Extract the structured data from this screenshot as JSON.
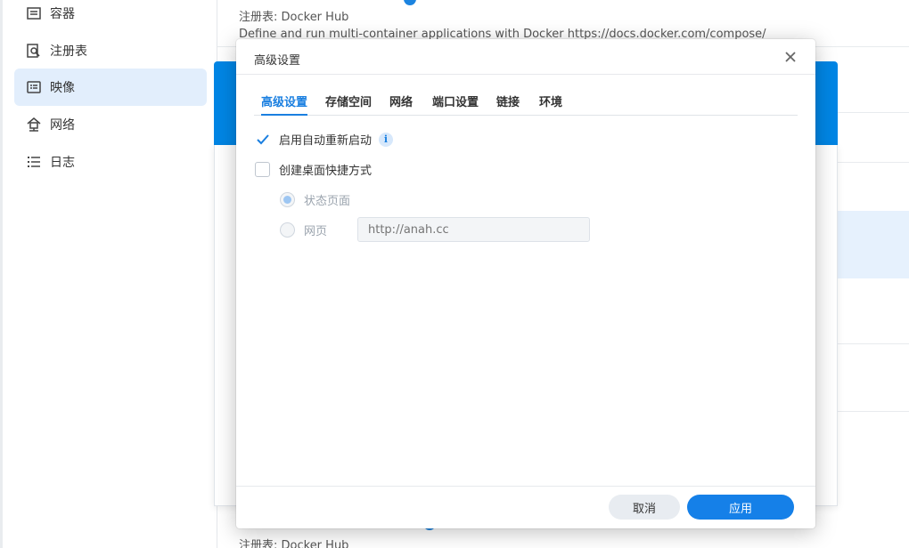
{
  "sidebar": {
    "items": [
      {
        "label": "容器",
        "icon": "container-list-icon"
      },
      {
        "label": "注册表",
        "icon": "registry-search-icon"
      },
      {
        "label": "映像",
        "icon": "image-icon",
        "active": true
      },
      {
        "label": "网络",
        "icon": "network-icon"
      },
      {
        "label": "日志",
        "icon": "log-list-icon"
      }
    ]
  },
  "background": {
    "registry_line": "注册表: Docker Hub",
    "description_line": "Define and run multi-container applications with Docker https://docs.docker.com/compose/",
    "registry_line_bottom": "注册表: Docker Hub"
  },
  "dialog": {
    "title": "高级设置",
    "tabs": [
      {
        "label": "高级设置",
        "active": true
      },
      {
        "label": "存储空间"
      },
      {
        "label": "网络"
      },
      {
        "label": "端口设置"
      },
      {
        "label": "链接"
      },
      {
        "label": "环境"
      }
    ],
    "auto_restart": {
      "label": "启用自动重新启动",
      "checked": true
    },
    "desktop_shortcut": {
      "label": "创建桌面快捷方式",
      "checked": false
    },
    "status_page": {
      "label": "状态页面",
      "selected": true
    },
    "web_page": {
      "label": "网页",
      "selected": false
    },
    "url_input": {
      "placeholder": "http://anah.cc"
    },
    "cancel_label": "取消",
    "apply_label": "应用"
  },
  "colors": {
    "accent": "#1580e8",
    "active_nav_bg": "#e2eefc",
    "header_blue": "#0086e5"
  }
}
